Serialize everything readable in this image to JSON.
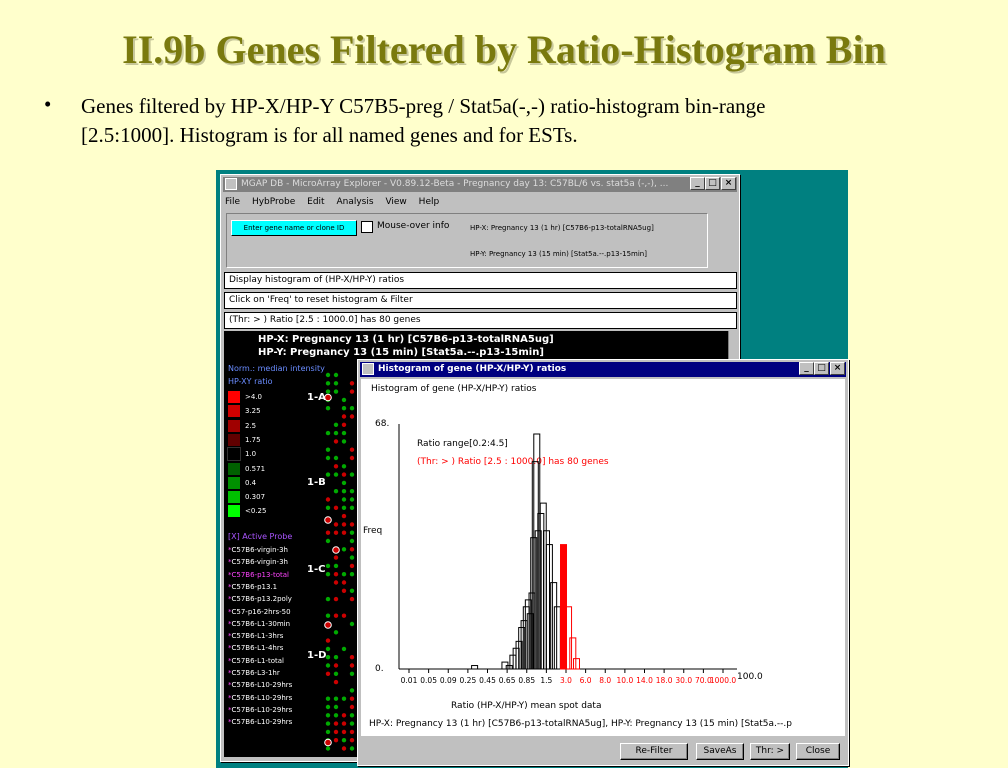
{
  "slide": {
    "title": "II.9b Genes Filtered by Ratio-Histogram Bin",
    "bullet": "•",
    "bullet_line1": "Genes filtered by HP-X/HP-Y  C57B5-preg / Stat5a(-,-)  ratio-histogram bin-range",
    "bullet_line2": "[2.5:1000]. Histogram is for all named genes and for ESTs."
  },
  "main_window": {
    "title": "MGAP DB - MicroArray Explorer - V0.89.12-Beta - Pregnancy day 13: C57BL/6 vs. stat5a (-,-), ...",
    "menu": [
      "File",
      "HybProbe",
      "Edit",
      "Analysis",
      "View",
      "Help"
    ],
    "gene_button": "Enter gene name or clone ID",
    "mouseover_label": "Mouse-over info",
    "hpx_info": "HP-X: Pregnancy 13  (1 hr) [C57B6-p13-totalRNA5ug]",
    "hpy_info": "HP-Y: Pregnancy 13  (15 min) [Stat5a.--.p13-15min]",
    "status1": "Display histogram of (HP-X/HP-Y) ratios",
    "status2": "Click on 'Freq' to reset histogram & Filter",
    "status3": "(Thr: > ) Ratio [2.5 : 1000.0] has 80 genes",
    "hdr_x": "HP-X: Pregnancy 13  (1 hr) [C57B6-p13-totalRNA5ug]",
    "hdr_y": "HP-Y: Pregnancy 13  (15 min) [Stat5a.--.p13-15min]",
    "norm_label": "Norm.: median intensity",
    "ratio_label": "HP-XY ratio",
    "legend": [
      {
        "label": ">4.0",
        "color": "#ff0000"
      },
      {
        "label": "3.25",
        "color": "#d00000"
      },
      {
        "label": "2.5",
        "color": "#a00000"
      },
      {
        "label": "1.75",
        "color": "#600000"
      },
      {
        "label": "1.0",
        "color": "#000000"
      },
      {
        "label": "0.571",
        "color": "#006000"
      },
      {
        "label": "0.4",
        "color": "#009000"
      },
      {
        "label": "0.307",
        "color": "#00c000"
      },
      {
        "label": "<0.25",
        "color": "#00ff00"
      }
    ],
    "active_probe_label": "[X] Active Probe",
    "probes": [
      {
        "label": "C57B6-virgin-3h",
        "selected": false
      },
      {
        "label": "C57B6-virgin-3h",
        "selected": false
      },
      {
        "label": "C57B6-p13-total",
        "selected": true
      },
      {
        "label": "C57B6-p13.1",
        "selected": false
      },
      {
        "label": "C57B6-p13.2poly",
        "selected": false
      },
      {
        "label": "C57-p16-2hrs-50",
        "selected": false
      },
      {
        "label": "C57B6-L1-30min",
        "selected": false
      },
      {
        "label": "C57B6-L1-3hrs",
        "selected": false
      },
      {
        "label": "C57B6-L1-4hrs",
        "selected": false
      },
      {
        "label": "C57B6-L1-total",
        "selected": false
      },
      {
        "label": "C57B6-L3-1hr",
        "selected": false
      },
      {
        "label": "C57B6-L10-29hrs",
        "selected": false
      },
      {
        "label": "C57B6-L10-29hrs",
        "selected": false
      },
      {
        "label": "C57B6-L10-29hrs",
        "selected": false
      },
      {
        "label": "C57B6-L10-29hrs",
        "selected": false
      }
    ],
    "grid_labels": [
      "1-A",
      "1-B",
      "1-C",
      "1-D"
    ]
  },
  "hist_window": {
    "title": "Histogram of gene (HP-X/HP-Y) ratios",
    "subtitle": "Histogram of gene (HP-X/HP-Y) ratios",
    "range_text": "Ratio range[0.2:4.5]",
    "thr_text": "(Thr: > ) Ratio [2.5 : 1000.0] has 80 genes",
    "footer": "HP-X: Pregnancy 13  (1 hr) [C57B6-p13-totalRNA5ug],  HP-Y: Pregnancy 13  (15 min) [Stat5a.--.p",
    "buttons": [
      "Re-Filter",
      "SaveAs",
      "Thr: >",
      "Close"
    ]
  },
  "chart_data": {
    "type": "bar",
    "ylabel": "Freq",
    "xlabel": "Ratio (HP-X/HP-Y) mean spot data",
    "y_ticks": [
      "68.",
      "0."
    ],
    "x_end_label": "100.0",
    "tick_labels": [
      "0.01",
      "0.05",
      "0.09",
      "0.25",
      "0.45",
      "0.65",
      "0.85",
      "1.5",
      "3.0",
      "6.0",
      "8.0",
      "10.0",
      "14.0",
      "18.0",
      "30.0",
      "70.0",
      "1000.0"
    ],
    "ylim": [
      0,
      68
    ],
    "series": [
      {
        "values": [
          {
            "x": 0.1,
            "y": 1,
            "color": "#000000",
            "filled": false
          },
          {
            "x": 0.3,
            "y": 2,
            "color": "#000000",
            "filled": false
          },
          {
            "x": 0.35,
            "y": 1,
            "color": "#000000",
            "filled": false
          },
          {
            "x": 0.4,
            "y": 4,
            "color": "#000000",
            "filled": false
          },
          {
            "x": 0.45,
            "y": 6,
            "color": "#000000",
            "filled": false
          },
          {
            "x": 0.5,
            "y": 8,
            "color": "#000000",
            "filled": false
          },
          {
            "x": 0.55,
            "y": 12,
            "color": "#000000",
            "filled": false
          },
          {
            "x": 0.6,
            "y": 14,
            "color": "#000000",
            "filled": false
          },
          {
            "x": 0.65,
            "y": 18,
            "color": "#000000",
            "filled": false
          },
          {
            "x": 0.7,
            "y": 20,
            "color": "#000000",
            "filled": false
          },
          {
            "x": 0.75,
            "y": 16,
            "color": "#000000",
            "filled": false
          },
          {
            "x": 0.8,
            "y": 22,
            "color": "#000000",
            "filled": false
          },
          {
            "x": 0.85,
            "y": 38,
            "color": "#000000",
            "filled": false
          },
          {
            "x": 0.9,
            "y": 60,
            "color": "#000000",
            "filled": false
          },
          {
            "x": 0.95,
            "y": 68,
            "color": "#000000",
            "filled": false
          },
          {
            "x": 1.0,
            "y": 40,
            "color": "#000000",
            "filled": false
          },
          {
            "x": 1.1,
            "y": 45,
            "color": "#000000",
            "filled": false
          },
          {
            "x": 1.2,
            "y": 48,
            "color": "#000000",
            "filled": false
          },
          {
            "x": 1.35,
            "y": 40,
            "color": "#000000",
            "filled": false
          },
          {
            "x": 1.5,
            "y": 36,
            "color": "#000000",
            "filled": false
          },
          {
            "x": 1.75,
            "y": 25,
            "color": "#000000",
            "filled": false
          },
          {
            "x": 2.0,
            "y": 18,
            "color": "#000000",
            "filled": false
          },
          {
            "x": 2.5,
            "y": 36,
            "color": "#ff0000",
            "filled": true
          },
          {
            "x": 3.0,
            "y": 18,
            "color": "#ff0000",
            "filled": false
          },
          {
            "x": 3.5,
            "y": 9,
            "color": "#ff0000",
            "filled": false
          },
          {
            "x": 4.0,
            "y": 3,
            "color": "#ff0000",
            "filled": false
          }
        ]
      }
    ]
  }
}
